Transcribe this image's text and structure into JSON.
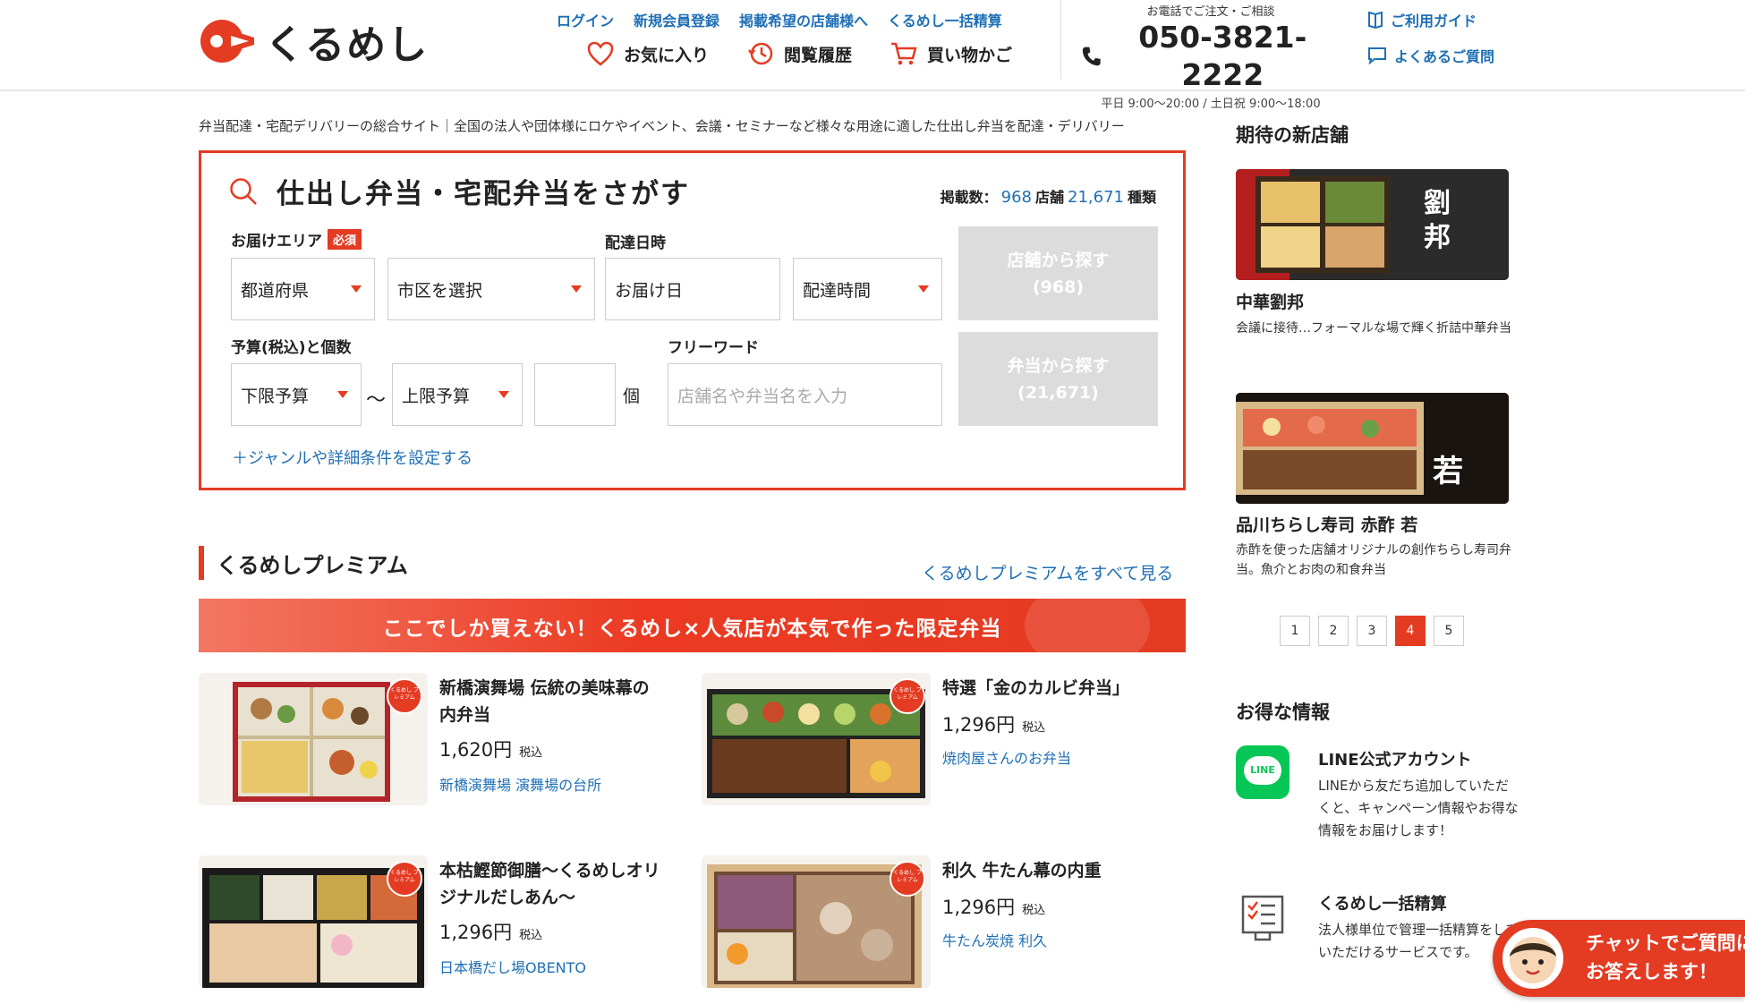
{
  "header": {
    "logo_text": "くるめし",
    "top_links": [
      "ログイン",
      "新規会員登録",
      "掲載希望の店舗様へ",
      "くるめし一括精算"
    ],
    "icon_links": [
      {
        "label": "お気に入り",
        "icon": "heart-icon"
      },
      {
        "label": "閲覧履歴",
        "icon": "history-clock-icon"
      },
      {
        "label": "買い物かご",
        "icon": "cart-icon"
      }
    ],
    "tel_note": "お電話でご注文・ご相談",
    "tel": "050-3821-2222",
    "tel_hours": "平日 9:00〜20:00 / 土日祝 9:00〜18:00",
    "guide": "ご利用ガイド",
    "faq": "よくあるご質問"
  },
  "tagline": "弁当配達・宅配デリバリーの総合サイト｜全国の法人や団体様にロケやイベント、会議・セミナーなど様々な用途に適した仕出し弁当を配達・デリバリー",
  "search": {
    "title": "仕出し弁当・宅配弁当をさがす",
    "count_label": "掲載数：",
    "store_count": "968",
    "store_unit": "店舗",
    "item_count": "21,671",
    "item_unit": "種類",
    "area_label": "お届けエリア",
    "required": "必須",
    "prefecture": "都道府県",
    "city": "市区を選択",
    "date_label": "配達日時",
    "date": "お届け日",
    "time": "配達時間",
    "budget_label": "予算(税込)と個数",
    "budget_min": "下限予算",
    "tilde": "〜",
    "budget_max": "上限予算",
    "qty_unit": "個",
    "freeword_label": "フリーワード",
    "freeword_placeholder": "店舗名や弁当名を入力",
    "btn_store": "店舗から探す",
    "btn_store_count": "(968)",
    "btn_bento": "弁当から探す",
    "btn_bento_count": "(21,671)",
    "detail_link": "＋ジャンルや詳細条件を設定する"
  },
  "premium": {
    "title": "くるめしプレミアム",
    "see_all": "くるめしプレミアムをすべて見る",
    "banner": "ここでしか買えない！くるめし×人気店が本気で作った限定弁当",
    "items": [
      {
        "name_l1": "新橋演舞場 伝統の美味幕の",
        "name_l2": "内弁当",
        "price": "1,620円",
        "tax": "税込",
        "shop": "新橋演舞場 演舞場の台所"
      },
      {
        "name_l1": "特選「金のカルビ弁当」",
        "name_l2": "",
        "price": "1,296円",
        "tax": "税込",
        "shop": "焼肉屋さんのお弁当"
      },
      {
        "name_l1": "本枯鰹節御膳〜くるめしオリ",
        "name_l2": "ジナルだしあん〜",
        "price": "1,296円",
        "tax": "税込",
        "shop": "日本橋だし場OBENTO"
      },
      {
        "name_l1": "利久 牛たん幕の内重",
        "name_l2": "",
        "price": "1,296円",
        "tax": "税込",
        "shop": "牛たん炭焼 利久"
      }
    ],
    "badge": "くるめし プレミアム"
  },
  "sidebar": {
    "new_title": "期待の新店舗",
    "stores": [
      {
        "name": "中華劉邦",
        "desc": "会議に接待…フォーマルな場で輝く折詰中華弁当",
        "sign": "劉邦"
      },
      {
        "name": "品川ちらし寿司 赤酢 若",
        "desc": "赤酢を使った店舗オリジナルの創作ちらし寿司弁当。魚介とお肉の和食弁当",
        "sign": "若"
      }
    ],
    "pages": [
      "1",
      "2",
      "3",
      "4",
      "5"
    ],
    "active_page": "4",
    "deals_title": "お得な情報",
    "line_title": "LINE公式アカウント",
    "line_desc": "LINEから友だち追加していただくと、キャンペーン情報やお得な情報をお届けします！",
    "line_icon_text": "LINE",
    "bulk_title": "くるめし一括精算",
    "bulk_desc": "法人様単位で管理一括精算をしていただけるサービスです。"
  },
  "chat": {
    "line1": "チャットでご質問に",
    "line2": "お答えします！"
  },
  "colors": {
    "accent": "#e43b23",
    "link": "#1f6fb5"
  }
}
